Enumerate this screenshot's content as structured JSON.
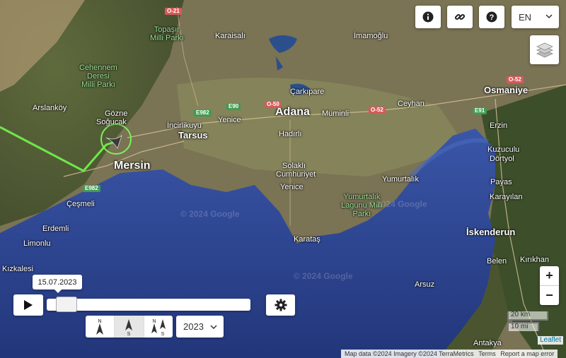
{
  "map": {
    "places": {
      "adana": "Adana",
      "mersin": "Mersin",
      "tarsus": "Tarsus",
      "osmaniye": "Osmaniye",
      "iskenderun": "İskenderun",
      "karaisali": "Karaisalı",
      "imamoglu": "İmamoğlu",
      "arslankoy": "Arslanköy",
      "gozne": "Gözne",
      "sogucak": "Soğucak",
      "incirlikuyu": "İncirlikuyu",
      "yenice1": "Yenice",
      "carkipare": "Çarkıpare",
      "muminli": "Müminli",
      "ceyhan": "Ceyhan",
      "erzin": "Erzin",
      "kuzuculu": "Kuzuculu",
      "dortyol": "Dörtyol",
      "hadirli": "Hadırlı",
      "solakli": "Solaklı",
      "cumhuriyet": "Cumhuriyet",
      "yenice2": "Yenice",
      "yumurtalik": "Yumurtalık",
      "payas": "Payas",
      "karayilan": "Karayılan",
      "cesmeli": "Çeşmeli",
      "erdemli": "Erdemli",
      "limonlu": "Limonlu",
      "kizkalesi": "Kızkalesi",
      "karatas": "Karataş",
      "belen": "Belen",
      "kirikhan": "Kırıkhan",
      "arsuz": "Arsuz",
      "antakya": "Antakya"
    },
    "parks": {
      "topasir": "Topaşır\nMilli Parkı",
      "cehennem": "Cehennem\nDeresi\nMilli Parkı",
      "yumurtalik_lagunu": "Yumurtalık\nLagünü Milli\nParkı"
    },
    "roads": {
      "o21": "O-21",
      "e982a": "E982",
      "e90": "E90",
      "o50": "O-50",
      "o52a": "O-52",
      "o52b": "O-52",
      "e91": "E91",
      "e982b": "E982"
    },
    "watermarks": {
      "wm1": "© 2024 Google",
      "wm2": "© 2024 Google",
      "wm3": "© 2024 Google"
    }
  },
  "controls": {
    "info_icon": "info-icon",
    "link_icon": "link-icon",
    "help_icon": "help-icon",
    "language": "EN",
    "layers_icon": "layers-icon",
    "zoom_in": "+",
    "zoom_out": "−",
    "scale_km": "20 km",
    "scale_mi": "10 mi"
  },
  "timeline": {
    "date_label": "15.07.2023",
    "slider_position": 0.05,
    "play_icon": "play-icon",
    "settings_icon": "gear-icon",
    "direction_options": [
      {
        "icon": "north-arrow-icon",
        "label": "N"
      },
      {
        "icon": "south-arrow-icon",
        "label": "S"
      },
      {
        "icon": "north-south-arrows-icon",
        "label": "N S"
      }
    ],
    "active_direction": 1,
    "year": "2023"
  },
  "attribution": {
    "map_data": "Map data ©2024 Imagery ©2024 TerraMetrics",
    "terms": "Terms",
    "report": "Report a map error",
    "leaflet": "Leaflet"
  },
  "colors": {
    "route": "#6ee84a",
    "sea": "#2a3f86",
    "land": "#6e6b4a",
    "marker_ring": "#7cf05a"
  }
}
